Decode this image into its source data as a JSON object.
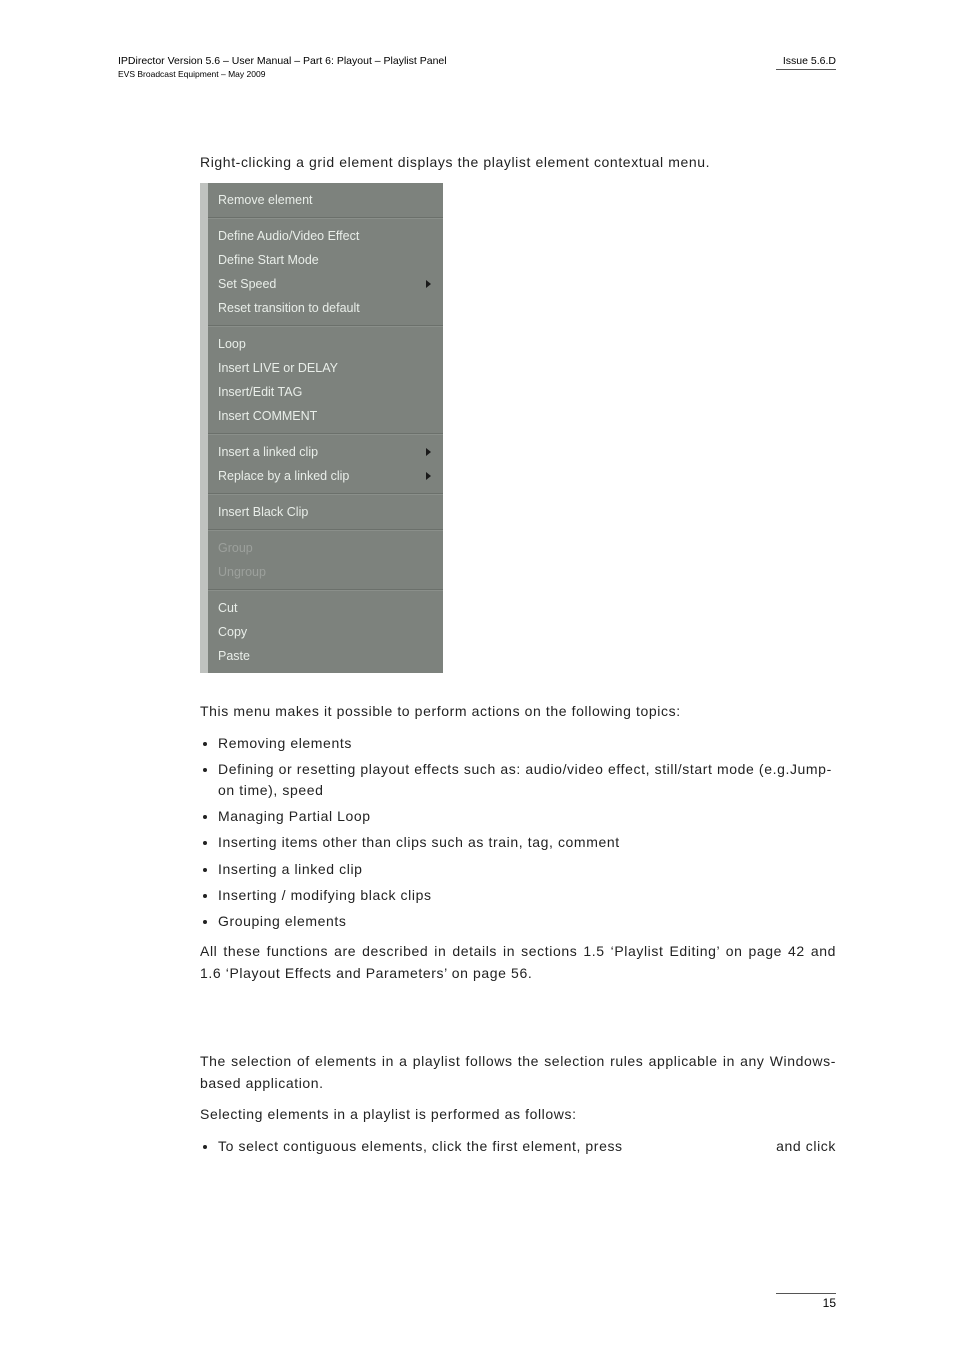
{
  "header": {
    "left_line1": "IPDirector Version 5.6 – User Manual – Part 6: Playout – Playlist Panel",
    "left_line2": "EVS Broadcast Equipment – May 2009",
    "right": "Issue 5.6.D"
  },
  "intro": "Right-clicking a grid element displays the playlist element contextual menu.",
  "menu": {
    "groups": [
      {
        "items": [
          {
            "label": "Remove element",
            "submenu": false,
            "disabled": false
          }
        ]
      },
      {
        "items": [
          {
            "label": "Define Audio/Video Effect",
            "submenu": false,
            "disabled": false
          },
          {
            "label": "Define Start Mode",
            "submenu": false,
            "disabled": false
          },
          {
            "label": "Set Speed",
            "submenu": true,
            "disabled": false
          },
          {
            "label": "Reset transition to default",
            "submenu": false,
            "disabled": false
          }
        ]
      },
      {
        "items": [
          {
            "label": "Loop",
            "submenu": false,
            "disabled": false
          },
          {
            "label": "Insert LIVE or DELAY",
            "submenu": false,
            "disabled": false
          },
          {
            "label": "Insert/Edit TAG",
            "submenu": false,
            "disabled": false
          },
          {
            "label": "Insert COMMENT",
            "submenu": false,
            "disabled": false
          }
        ]
      },
      {
        "items": [
          {
            "label": "Insert a linked clip",
            "submenu": true,
            "disabled": false
          },
          {
            "label": "Replace by a linked clip",
            "submenu": true,
            "disabled": false
          }
        ]
      },
      {
        "items": [
          {
            "label": "Insert Black Clip",
            "submenu": false,
            "disabled": false
          }
        ]
      },
      {
        "items": [
          {
            "label": "Group",
            "submenu": false,
            "disabled": true
          },
          {
            "label": "Ungroup",
            "submenu": false,
            "disabled": true
          }
        ]
      },
      {
        "items": [
          {
            "label": "Cut",
            "submenu": false,
            "disabled": false
          },
          {
            "label": "Copy",
            "submenu": false,
            "disabled": false
          },
          {
            "label": "Paste",
            "submenu": false,
            "disabled": false
          }
        ]
      }
    ]
  },
  "after_menu": "This menu makes it possible to perform actions on the following topics:",
  "topics": [
    "Removing elements",
    "Defining or resetting playout effects such as: audio/video effect, still/start mode (e.g.Jump-on time), speed",
    "Managing Partial Loop",
    "Inserting items other than clips such as train, tag, comment",
    "Inserting a linked clip",
    "Inserting / modifying black clips",
    "Grouping elements"
  ],
  "closing": "All these functions are described in details in sections 1.5 ‘Playlist Editing’ on page 42 and 1.6 ‘Playout Effects and Parameters’ on page 56.",
  "selection_p1": "The selection of elements in a playlist follows the selection rules applicable in any Windows-based application.",
  "selection_p2": "Selecting elements in a playlist is performed as follows:",
  "selection_bullet_a": "To select contiguous elements, click the first element, press ",
  "selection_bullet_b": " and click",
  "footer": {
    "page": "15"
  }
}
